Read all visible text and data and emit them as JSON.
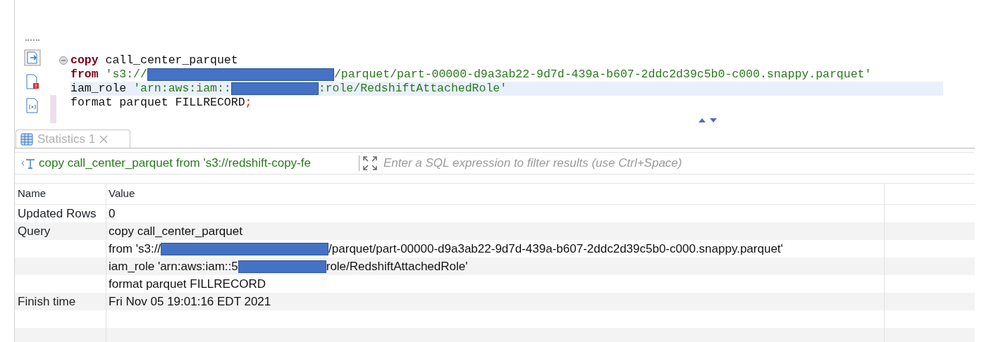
{
  "editor": {
    "lines": [
      {
        "foldable": true,
        "current": false,
        "segments": [
          {
            "kind": "keyword",
            "text": "copy"
          },
          {
            "kind": "plain",
            "text": " call_center_parquet"
          }
        ]
      },
      {
        "foldable": false,
        "current": false,
        "segments": [
          {
            "kind": "keyword",
            "text": "from"
          },
          {
            "kind": "string",
            "text": " 's3://"
          },
          {
            "kind": "redacted"
          },
          {
            "kind": "string",
            "text": "/parquet/part-00000-d9a3ab22-9d7d-439a-b607-2ddc2d39c5b0-c000.snappy.parquet'"
          }
        ]
      },
      {
        "foldable": false,
        "current": true,
        "segments": [
          {
            "kind": "plain",
            "text": "iam_role "
          },
          {
            "kind": "string",
            "text": "'arn:aws:iam::"
          },
          {
            "kind": "redacted"
          },
          {
            "kind": "string",
            "text": ":role/RedshiftAttachedRole'"
          }
        ]
      },
      {
        "foldable": false,
        "current": false,
        "segments": [
          {
            "kind": "plain",
            "text": "format parquet FILLRECORD"
          },
          {
            "kind": "punct",
            "text": ";"
          }
        ]
      }
    ]
  },
  "results_tab": {
    "label": "Statistics 1",
    "selected": true
  },
  "filter": {
    "query_text": "copy call_center_parquet from 's3://redshift-copy-fe",
    "placeholder": "Enter a SQL expression to filter results (use Ctrl+Space)"
  },
  "table": {
    "columns": [
      "Name",
      "Value"
    ],
    "rows": [
      {
        "name": "Updated Rows",
        "value": [
          {
            "kind": "plain",
            "text": "0"
          }
        ]
      },
      {
        "name": "Query",
        "value": [
          {
            "kind": "plain",
            "text": "copy call_center_parquet"
          }
        ]
      },
      {
        "value": [
          {
            "kind": "plain",
            "text": "from 's3://"
          },
          {
            "kind": "redacted"
          },
          {
            "kind": "plain",
            "text": "/parquet/part-00000-d9a3ab22-9d7d-439a-b607-2ddc2d39c5b0-c000.snappy.parquet'"
          }
        ]
      },
      {
        "value": [
          {
            "kind": "plain",
            "text": "iam_role 'arn:aws:iam::5"
          },
          {
            "kind": "redacted"
          },
          {
            "kind": "plain",
            "text": "role/RedshiftAttachedRole'"
          }
        ]
      },
      {
        "value": [
          {
            "kind": "plain",
            "text": "format parquet FILLRECORD"
          }
        ]
      },
      {
        "name": "Finish time",
        "value": [
          {
            "kind": "plain",
            "text": "Fri Nov 05 19:01:16 EDT 2021"
          }
        ]
      }
    ]
  }
}
